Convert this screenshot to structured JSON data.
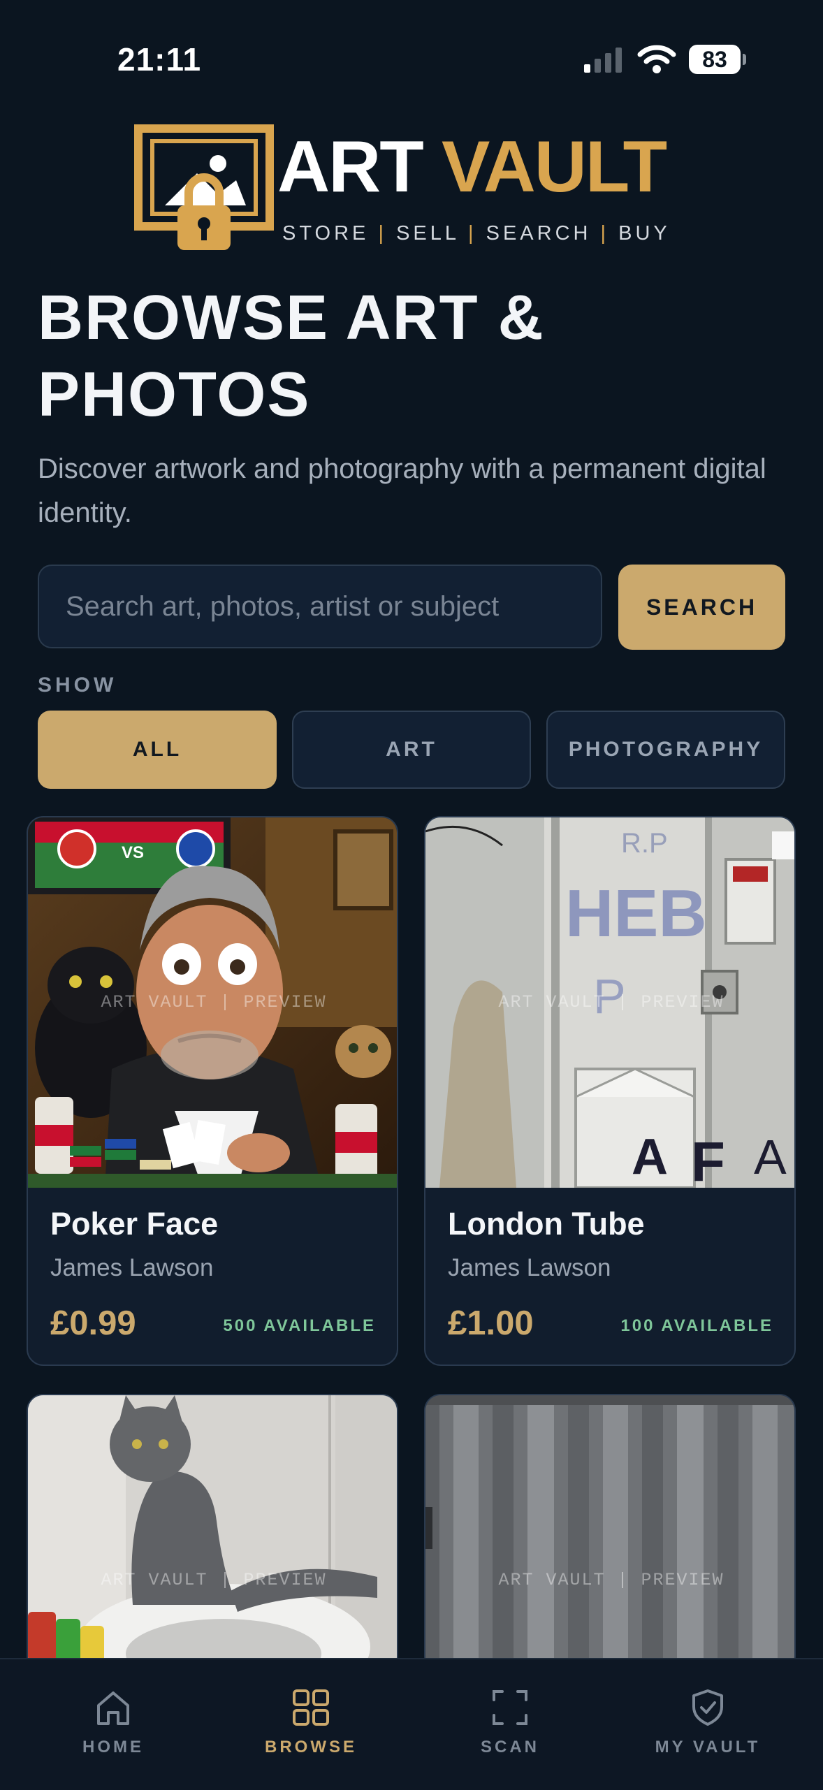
{
  "status_bar": {
    "time": "21:11",
    "battery": "83"
  },
  "logo": {
    "word_art": "ART",
    "word_vault": "VAULT",
    "tagline": [
      "STORE",
      "SELL",
      "SEARCH",
      "BUY"
    ],
    "tagline_separator": "|"
  },
  "header": {
    "title": "BROWSE ART & PHOTOS",
    "subtitle": "Discover artwork and photography with a permanent digital identity."
  },
  "search": {
    "placeholder": "Search art, photos, artist or subject",
    "value": "",
    "button_label": "SEARCH"
  },
  "filters": {
    "label": "SHOW",
    "options": [
      {
        "label": "ALL",
        "selected": true
      },
      {
        "label": "ART",
        "selected": false
      },
      {
        "label": "PHOTOGRAPHY",
        "selected": false
      }
    ]
  },
  "listings": [
    {
      "title": "Poker Face",
      "artist": "James Lawson",
      "price": "£0.99",
      "availability": "500 AVAILABLE",
      "watermark": "ART VAULT | PREVIEW"
    },
    {
      "title": "London Tube",
      "artist": "James Lawson",
      "price": "£1.00",
      "availability": "100 AVAILABLE",
      "watermark": "ART VAULT | PREVIEW"
    },
    {
      "watermark": "ART VAULT | PREVIEW"
    },
    {
      "watermark": "ART VAULT | PREVIEW"
    }
  ],
  "bottom_nav": {
    "items": [
      {
        "label": "HOME",
        "icon": "home-icon",
        "active": false
      },
      {
        "label": "BROWSE",
        "icon": "grid-icon",
        "active": true
      },
      {
        "label": "SCAN",
        "icon": "scan-icon",
        "active": false
      },
      {
        "label": "MY VAULT",
        "icon": "shield-check-icon",
        "active": false
      }
    ]
  },
  "colors": {
    "background": "#0b1520",
    "accent_gold": "#cba96d",
    "available_green": "#7fc79a",
    "card_background": "#111d2d"
  }
}
